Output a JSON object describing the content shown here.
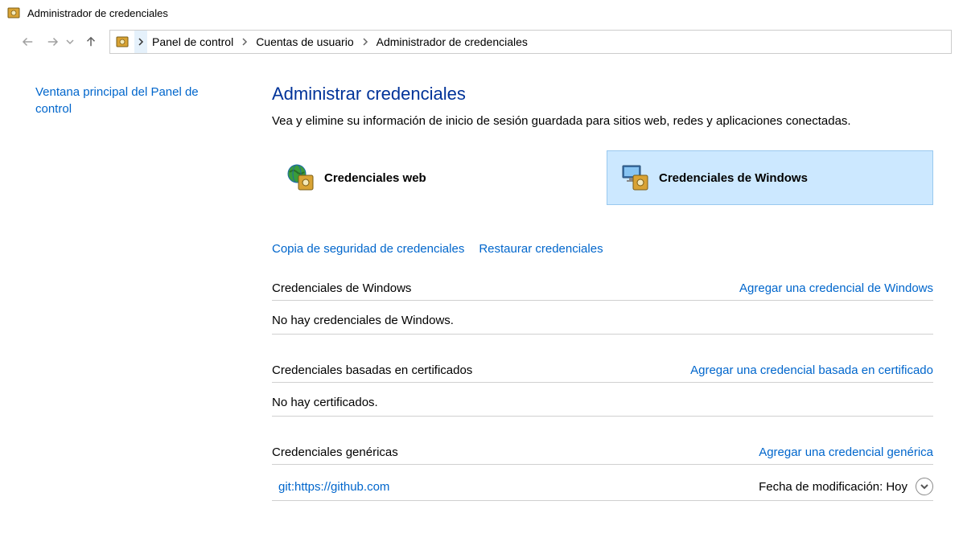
{
  "window": {
    "title": "Administrador de credenciales"
  },
  "breadcrumb": {
    "items": [
      "Panel de control",
      "Cuentas de usuario",
      "Administrador de credenciales"
    ]
  },
  "sidebar": {
    "home_link": "Ventana principal del Panel de control"
  },
  "main": {
    "title": "Administrar credenciales",
    "description": "Vea y elimine su información de inicio de sesión guardada para sitios web, redes y aplicaciones conectadas.",
    "tabs": {
      "web": "Credenciales web",
      "windows": "Credenciales de Windows"
    },
    "actions": {
      "backup": "Copia de seguridad de credenciales",
      "restore": "Restaurar credenciales"
    },
    "sections": {
      "windows": {
        "title": "Credenciales de Windows",
        "add": "Agregar una credencial de Windows",
        "empty": "No hay credenciales de Windows."
      },
      "cert": {
        "title": "Credenciales basadas en certificados",
        "add": "Agregar una credencial basada en certificado",
        "empty": "No hay certificados."
      },
      "generic": {
        "title": "Credenciales genéricas",
        "add": "Agregar una credencial genérica",
        "items": [
          {
            "name": "git:https://github.com",
            "modified_label": "Fecha de modificación:",
            "modified_value": "Hoy"
          }
        ]
      }
    }
  }
}
